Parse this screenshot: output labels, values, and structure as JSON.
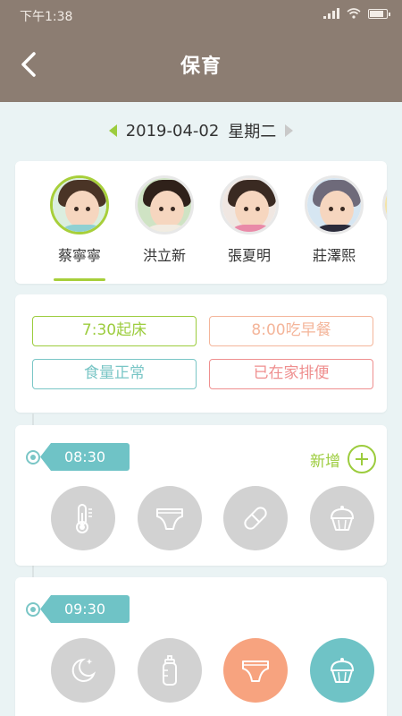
{
  "status_bar": {
    "time": "下午1:38"
  },
  "header": {
    "title": "保育"
  },
  "date_bar": {
    "date": "2019-04-02",
    "weekday": "星期二"
  },
  "children": [
    {
      "name": "蔡寧寧",
      "selected": true
    },
    {
      "name": "洪立新",
      "selected": false
    },
    {
      "name": "張夏明",
      "selected": false
    },
    {
      "name": "莊澤熙",
      "selected": false
    }
  ],
  "daily_status": [
    {
      "label": "7:30起床",
      "color": "#9ccc3d"
    },
    {
      "label": "8:00吃早餐",
      "color": "#f4b59a"
    },
    {
      "label": "食量正常",
      "color": "#7ac6c6"
    },
    {
      "label": "已在家排便",
      "color": "#ef8f8f"
    }
  ],
  "entries": [
    {
      "time": "08:30",
      "add_label": "新增",
      "actions": [
        {
          "icon": "thermometer-icon",
          "color": "#d2d2d2"
        },
        {
          "icon": "diaper-icon",
          "color": "#d2d2d2"
        },
        {
          "icon": "medicine-pill-icon",
          "color": "#d2d2d2"
        },
        {
          "icon": "cupcake-icon",
          "color": "#d2d2d2"
        }
      ]
    },
    {
      "time": "09:30",
      "actions": [
        {
          "icon": "moon-sleep-icon",
          "color": "#d2d2d2"
        },
        {
          "icon": "baby-bottle-icon",
          "color": "#d2d2d2"
        },
        {
          "icon": "diaper-icon",
          "color": "#f7a37f"
        },
        {
          "icon": "cupcake-icon",
          "color": "#6fc3c6"
        }
      ]
    }
  ]
}
